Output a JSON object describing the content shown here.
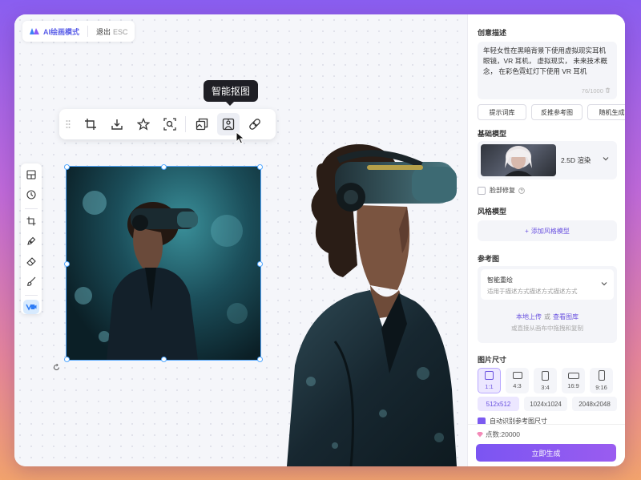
{
  "topbar": {
    "mode": "AI绘画模式",
    "exit": "退出",
    "esc": "ESC"
  },
  "tooltip": "智能抠图",
  "toolbar": {
    "tools": [
      "drag-handle",
      "crop",
      "download",
      "favorite",
      "zoom-scan",
      "image-variation",
      "smart-cutout",
      "erase-fix"
    ],
    "active_tool": "smart-cutout"
  },
  "leftbar": {
    "tools": [
      "layout",
      "history",
      "crop",
      "pen",
      "eraser",
      "brush",
      "video"
    ]
  },
  "sidebar": {
    "prompt": {
      "title": "创意描述",
      "text": "年轻女性在黑暗背景下使用虚拟现实耳机眼镜，VR 耳机， 虚拟现实， 未来技术概念， 在彩色霓虹灯下使用 VR 耳机",
      "count": "76/1000",
      "chips": [
        "提示词库",
        "反推参考图",
        "随机生成"
      ]
    },
    "model": {
      "title": "基础模型",
      "name": "2.5D 渲染",
      "face_fix": "脸部修复"
    },
    "style": {
      "title": "风格模型",
      "add": "添加风格模型"
    },
    "reference": {
      "title": "参考图",
      "option_title": "智能重绘",
      "option_desc": "适用于描述方式描述方式描述方式",
      "upload": "本地上传",
      "or": "或",
      "gallery": "查看图库",
      "hint": "或直接从画布中拖拽和复制"
    },
    "size": {
      "title": "图片尺寸",
      "ratios": [
        "1:1",
        "4:3",
        "3:4",
        "16:9",
        "9:16"
      ],
      "active_ratio": "1:1",
      "sizes": [
        "512x512",
        "1024x1024",
        "2048x2048"
      ],
      "active_size": "512x512",
      "auto_detect": "自动识别参考图尺寸"
    },
    "points": "点数:20000",
    "generate": "立即生成"
  },
  "colors": {
    "accent": "#7b55f2",
    "selection": "#53a8ff"
  }
}
